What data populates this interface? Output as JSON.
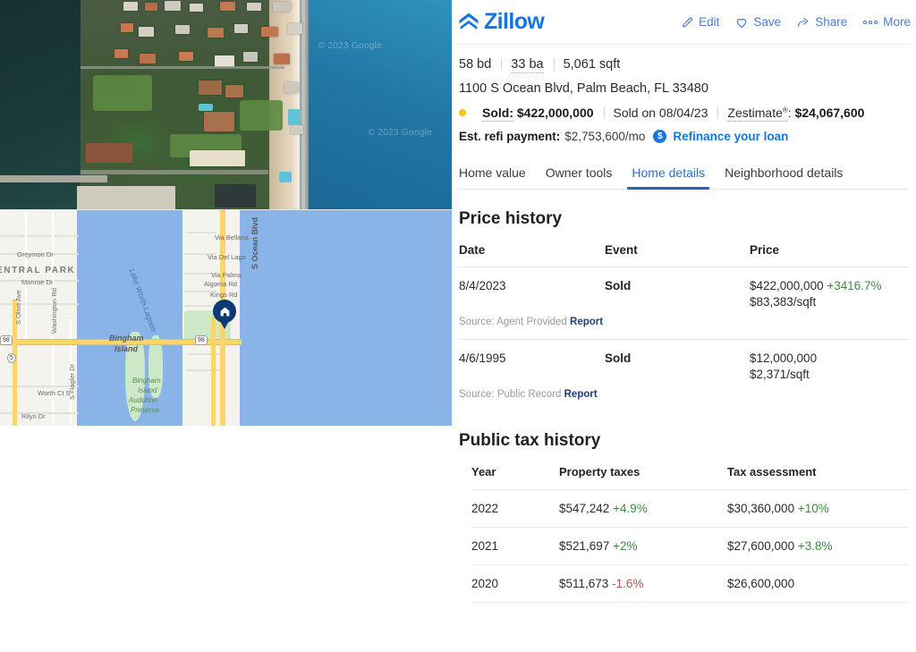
{
  "brand": {
    "name": "Zillow",
    "logo_color": "#1277e1"
  },
  "header": {
    "actions": [
      {
        "label": "Edit",
        "icon": "pencil-icon"
      },
      {
        "label": "Save",
        "icon": "heart-icon"
      },
      {
        "label": "Share",
        "icon": "share-arrow-icon"
      },
      {
        "label": "More",
        "icon": "ellipsis-icon"
      }
    ]
  },
  "property": {
    "beds": "58 bd",
    "baths": "33 ba",
    "sqft": "5,061 sqft",
    "address": "1100 S Ocean Blvd, Palm Beach, FL 33480",
    "status_label": "Sold:",
    "status_price": "$422,000,000",
    "sold_on": "Sold on 08/04/23",
    "zestimate_label": "Zestimate",
    "zestimate_sup": "®",
    "zestimate_colon": ":",
    "zestimate_value": "$24,067,600",
    "refi_label": "Est. refi payment:",
    "refi_value": "$2,753,600/mo",
    "refi_icon_text": "$",
    "refi_link": "Refinance your loan",
    "status_dot_color": "#f5c518"
  },
  "tabs": [
    {
      "label": "Home value",
      "active": false
    },
    {
      "label": "Owner tools",
      "active": false
    },
    {
      "label": "Home details",
      "active": true
    },
    {
      "label": "Neighborhood details",
      "active": false
    }
  ],
  "price_history": {
    "title": "Price history",
    "columns": [
      "Date",
      "Event",
      "Price"
    ],
    "rows": [
      {
        "date": "8/4/2023",
        "event": "Sold",
        "price": "$422,000,000",
        "change": "+3416.7%",
        "change_dir": "positive",
        "per_sqft": "$83,383/sqft",
        "source_label": "Source: Agent Provided",
        "source_link": "Report"
      },
      {
        "date": "4/6/1995",
        "event": "Sold",
        "price": "$12,000,000",
        "change": "",
        "change_dir": "none",
        "per_sqft": "$2,371/sqft",
        "source_label": "Source: Public Record",
        "source_link": "Report"
      }
    ]
  },
  "tax_history": {
    "title": "Public tax history",
    "columns": [
      "Year",
      "Property taxes",
      "Tax assessment"
    ],
    "rows": [
      {
        "year": "2022",
        "property_taxes": "$547,242",
        "property_taxes_change": "+4.9%",
        "property_taxes_dir": "positive",
        "assessment": "$30,360,000",
        "assessment_change": "+10%",
        "assessment_dir": "positive"
      },
      {
        "year": "2021",
        "property_taxes": "$521,697",
        "property_taxes_change": "+2%",
        "property_taxes_dir": "positive",
        "assessment": "$27,600,000",
        "assessment_change": "+3.8%",
        "assessment_dir": "positive"
      },
      {
        "year": "2020",
        "property_taxes": "$511,673",
        "property_taxes_change": "-1.6%",
        "property_taxes_dir": "negative",
        "assessment": "$26,600,000",
        "assessment_change": "",
        "assessment_dir": "none"
      }
    ]
  },
  "colors": {
    "positive": "#3f8a3f",
    "negative": "#c0504d",
    "link": "#1277e1",
    "tab_active": "#2f6fd0"
  },
  "aerial": {
    "watermarks": [
      "© 2023 Google",
      "© 2023 Google"
    ]
  },
  "map": {
    "labels": [
      "Greymon Dr",
      "ENTRAL PARK",
      "Monroe Dr",
      "S Olive Ave",
      "Washington Rd",
      "S Flagler Dr",
      "Worth Ct S",
      "Rilyn Dr",
      "Lake Worth Lagoon",
      "Bingham Island",
      "Bingham Island Audubon Preserve",
      "Via Bellaria",
      "Via Del Lago",
      "Via Palma",
      "Algoma Rd",
      "Kings Rd",
      "S Ocean Blvd"
    ],
    "highway_shields": [
      "98",
      "98",
      "5"
    ],
    "marker": "home-marker-pin"
  }
}
